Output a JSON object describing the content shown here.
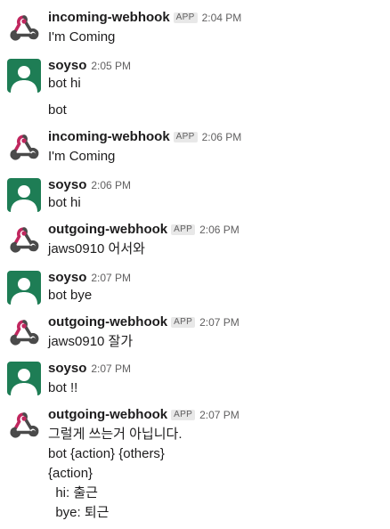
{
  "messages": [
    {
      "sender": "incoming-webhook",
      "is_app": true,
      "app_badge": "APP",
      "time": "2:04 PM",
      "avatar": "webhook-icon",
      "lines": [
        "I'm Coming"
      ]
    },
    {
      "sender": "soyso",
      "is_app": false,
      "time": "2:05 PM",
      "avatar": "user-avatar",
      "lines": [
        "bot hi",
        "",
        "bot"
      ]
    },
    {
      "sender": "incoming-webhook",
      "is_app": true,
      "app_badge": "APP",
      "time": "2:06 PM",
      "avatar": "webhook-icon",
      "lines": [
        "I'm Coming"
      ]
    },
    {
      "sender": "soyso",
      "is_app": false,
      "time": "2:06 PM",
      "avatar": "user-avatar",
      "lines": [
        "bot hi"
      ]
    },
    {
      "sender": "outgoing-webhook",
      "is_app": true,
      "app_badge": "APP",
      "time": "2:06 PM",
      "avatar": "webhook-icon",
      "lines": [
        "jaws0910 어서와"
      ]
    },
    {
      "sender": "soyso",
      "is_app": false,
      "time": "2:07 PM",
      "avatar": "user-avatar",
      "lines": [
        "bot bye"
      ]
    },
    {
      "sender": "outgoing-webhook",
      "is_app": true,
      "app_badge": "APP",
      "time": "2:07 PM",
      "avatar": "webhook-icon",
      "lines": [
        "jaws0910 잘가"
      ]
    },
    {
      "sender": "soyso",
      "is_app": false,
      "time": "2:07 PM",
      "avatar": "user-avatar",
      "lines": [
        "bot !!"
      ]
    },
    {
      "sender": "outgoing-webhook",
      "is_app": true,
      "app_badge": "APP",
      "time": "2:07 PM",
      "avatar": "webhook-icon",
      "lines": [
        "그럴게 쓰는거 아닙니다.",
        "bot {action} {others}",
        "{action}",
        "  hi: 출근",
        "  bye: 퇴근"
      ]
    }
  ],
  "colors": {
    "webhook_pink": "#c1275f",
    "webhook_dark": "#4a4a4a",
    "user_avatar_bg": "#1e7d55",
    "user_avatar_fg": "#ffffff"
  }
}
